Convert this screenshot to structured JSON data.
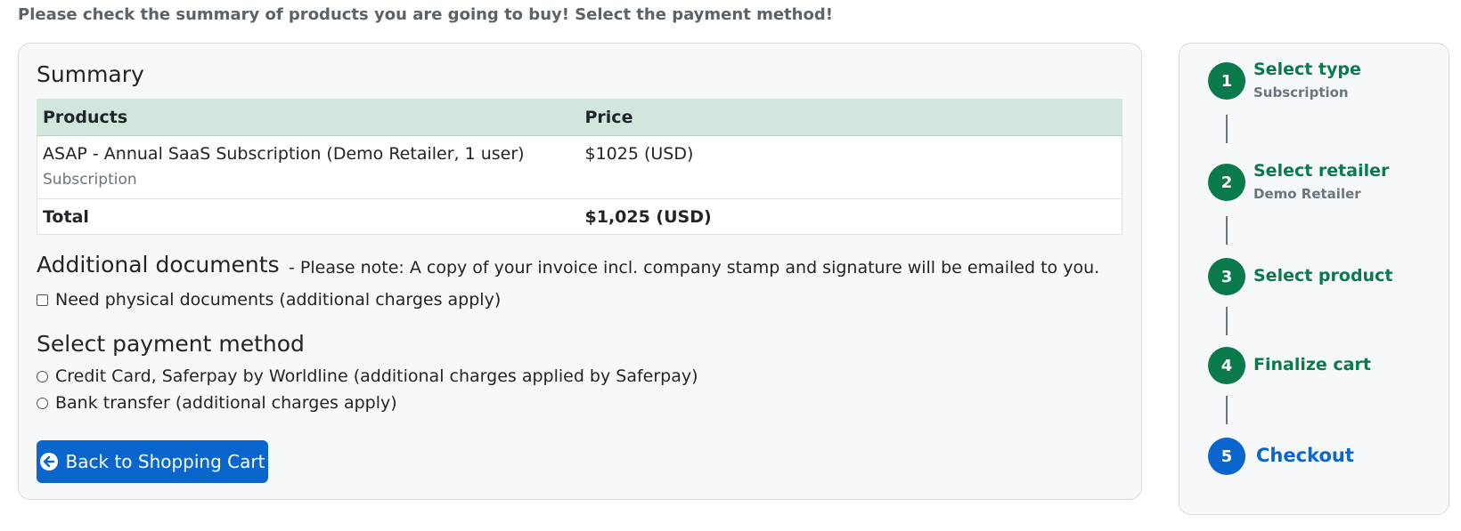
{
  "intro": "Please check the summary of products you are going to buy! Select the payment method!",
  "summary": {
    "title": "Summary",
    "columns": [
      "Products",
      "Price"
    ],
    "rows": [
      {
        "product": "ASAP - Annual SaaS Subscription (Demo Retailer, 1 user)",
        "type": "Subscription",
        "price": "$1025 (USD)"
      }
    ],
    "total_label": "Total",
    "total_value": "$1,025 (USD)"
  },
  "documents": {
    "title": "Additional documents",
    "note": "- Please note: A copy of your invoice incl. company stamp and signature will be emailed to you.",
    "checkbox_label": "Need physical documents (additional charges apply)",
    "checked": false
  },
  "payment": {
    "title": "Select payment method",
    "options": [
      "Credit Card, Saferpay by Worldline (additional charges applied by Saferpay)",
      "Bank transfer (additional charges apply)"
    ],
    "selected": null
  },
  "back_button": {
    "label": "Back to Shopping Cart",
    "icon": "arrow-left-circle-icon"
  },
  "steps": [
    {
      "number": "1",
      "title": "Select type",
      "subtitle": "Subscription",
      "state": "done"
    },
    {
      "number": "2",
      "title": "Select retailer",
      "subtitle": "Demo Retailer",
      "state": "done"
    },
    {
      "number": "3",
      "title": "Select product",
      "subtitle": "",
      "state": "done"
    },
    {
      "number": "4",
      "title": "Finalize cart",
      "subtitle": "",
      "state": "done"
    },
    {
      "number": "5",
      "title": "Checkout",
      "subtitle": "",
      "state": "active"
    }
  ],
  "colors": {
    "primary": "#0a66cc",
    "success": "#0a7a4d",
    "table_header": "#d1e7dd",
    "card_bg": "#f7f8f9"
  }
}
